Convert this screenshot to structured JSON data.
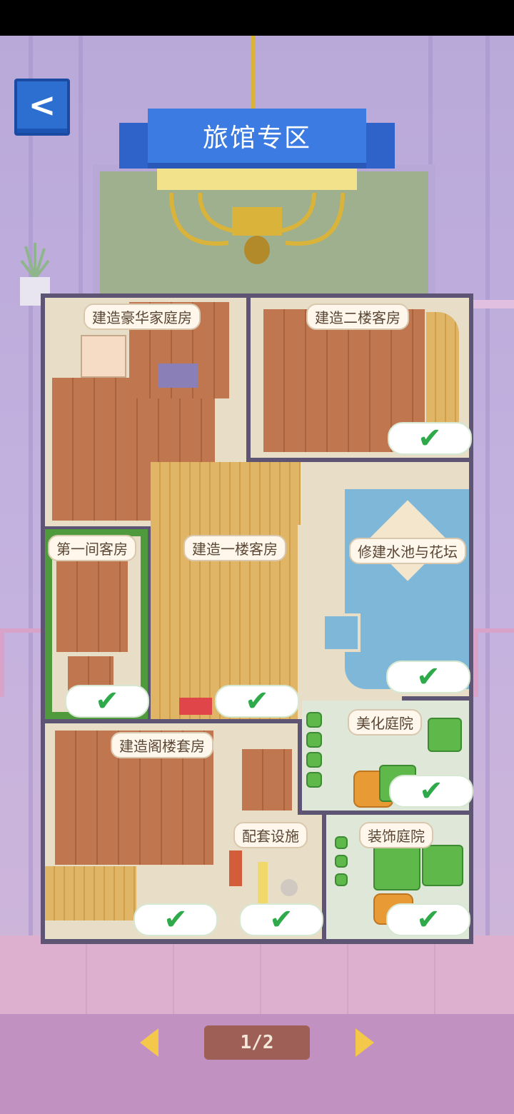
{
  "header": {
    "back_label": "<",
    "title": "旅馆专区"
  },
  "rooms": [
    {
      "label": "建造豪华家庭房",
      "completed": true
    },
    {
      "label": "建造二楼客房",
      "completed": true
    },
    {
      "label": "第一间客房",
      "completed": true
    },
    {
      "label": "建造一楼客房",
      "completed": true
    },
    {
      "label": "修建水池与花坛",
      "completed": true
    },
    {
      "label": "美化庭院",
      "completed": true
    },
    {
      "label": "建造阁楼套房",
      "completed": true
    },
    {
      "label": "配套设施",
      "completed": true
    },
    {
      "label": "装饰庭院",
      "completed": true
    }
  ],
  "check_icon": "✔",
  "pager": {
    "text": "1/2"
  },
  "colors": {
    "banner": "#3b7be2",
    "check": "#2faa4a",
    "back_button": "#2d6fd1"
  }
}
